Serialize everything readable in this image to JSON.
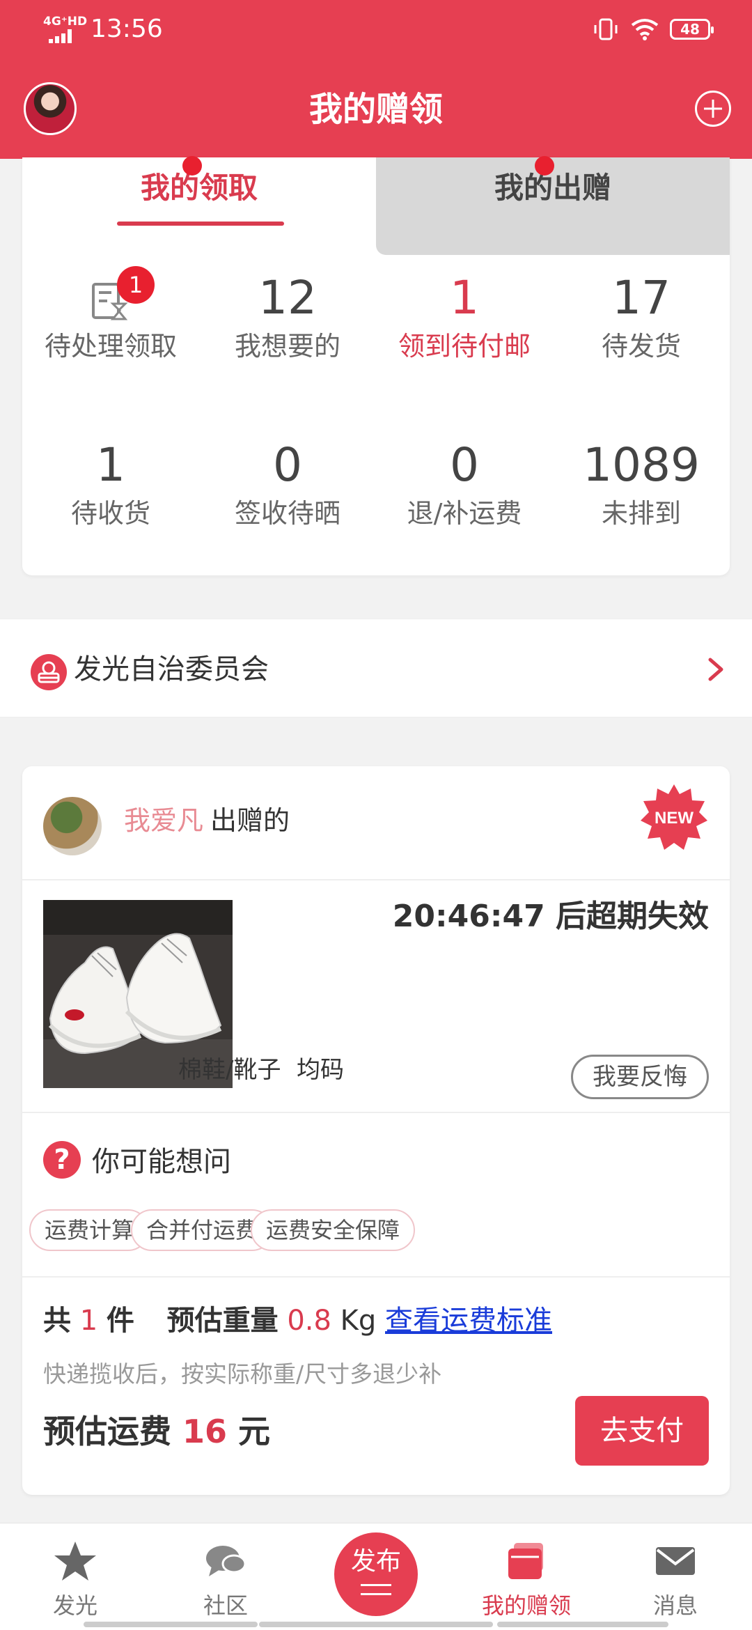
{
  "status_bar": {
    "network": "4G⁺HD",
    "time": "13:56",
    "battery": "48"
  },
  "header": {
    "title": "我的赠领"
  },
  "tabs": [
    {
      "label": "我的领取",
      "active": true
    },
    {
      "label": "我的出赠",
      "active": false
    }
  ],
  "stats": [
    {
      "value": "",
      "label": "待处理领取",
      "badge": "1",
      "icon": "pending-doc-icon"
    },
    {
      "value": "12",
      "label": "我想要的"
    },
    {
      "value": "1",
      "label": "领到待付邮",
      "highlight": true
    },
    {
      "value": "17",
      "label": "待发货"
    },
    {
      "value": "1",
      "label": "待收货"
    },
    {
      "value": "0",
      "label": "签收待晒"
    },
    {
      "value": "0",
      "label": "退/补运费"
    },
    {
      "value": "1089",
      "label": "未排到"
    }
  ],
  "committee": {
    "label": "发光自治委员会"
  },
  "gift_card": {
    "giver_name": "我爱凡",
    "giver_suffix": "出赠的",
    "new_badge": "NEW",
    "countdown": "20:46:47 后超期失效",
    "category": "棉鞋/靴子",
    "size": "均码",
    "regret_button": "我要反悔",
    "faq_title": "你可能想问",
    "faq_chips": [
      "运费计算",
      "合并付运费",
      "运费安全保障"
    ],
    "total_prefix": "共",
    "count": "1",
    "count_unit": "件",
    "weight_label": "预估重量",
    "weight_value": "0.8",
    "weight_unit": "Kg",
    "shipping_standard_link": "查看运费标准",
    "note": "快递揽收后，按实际称重/尺寸多退少补",
    "fee_label": "预估运费",
    "fee_value": "16",
    "fee_unit": "元",
    "pay_button": "去支付"
  },
  "bottom_nav": {
    "items": [
      {
        "label": "发光",
        "icon": "star-icon"
      },
      {
        "label": "社区",
        "icon": "chat-bubble-icon"
      },
      {
        "label": "我的赠领",
        "icon": "gift-cards-icon",
        "active": true
      },
      {
        "label": "消息",
        "icon": "envelope-icon"
      }
    ],
    "publish_label": "发布"
  },
  "colors": {
    "brand": "#e63f52",
    "accent_text": "#d93b4e",
    "link": "#1a3cd9"
  }
}
